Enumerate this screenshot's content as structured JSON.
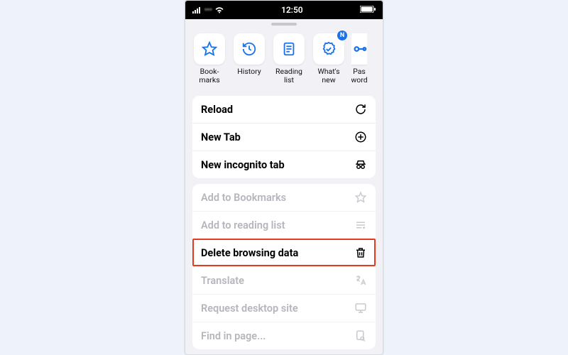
{
  "status": {
    "time": "12:50",
    "carrier": "•••"
  },
  "topRow": [
    {
      "id": "bookmarks",
      "label": "Book-\nmarks",
      "icon": "star"
    },
    {
      "id": "history",
      "label": "History",
      "icon": "history"
    },
    {
      "id": "reading-list",
      "label": "Reading\nlist",
      "icon": "reading"
    },
    {
      "id": "whats-new",
      "label": "What's\nnew",
      "icon": "badge-check",
      "badge": "N"
    },
    {
      "id": "password",
      "label": "Pas\nword",
      "icon": "key",
      "cut": true
    }
  ],
  "actionsPrimary": [
    {
      "id": "reload",
      "label": "Reload",
      "icon": "reload"
    },
    {
      "id": "new-tab",
      "label": "New Tab",
      "icon": "plus-circle"
    },
    {
      "id": "incognito",
      "label": "New incognito tab",
      "icon": "incognito"
    }
  ],
  "actionsSecondary": [
    {
      "id": "add-bookmark",
      "label": "Add to Bookmarks",
      "icon": "star-outline",
      "disabled": true
    },
    {
      "id": "add-reading",
      "label": "Add to reading list",
      "icon": "reading-add",
      "disabled": true
    },
    {
      "id": "delete-data",
      "label": "Delete browsing data",
      "icon": "trash",
      "highlight": true
    },
    {
      "id": "translate",
      "label": "Translate",
      "icon": "translate",
      "disabled": true
    },
    {
      "id": "desktop-site",
      "label": "Request desktop site",
      "icon": "desktop",
      "disabled": true
    },
    {
      "id": "find-in-page",
      "label": "Find in page...",
      "icon": "find",
      "disabled": true
    }
  ]
}
